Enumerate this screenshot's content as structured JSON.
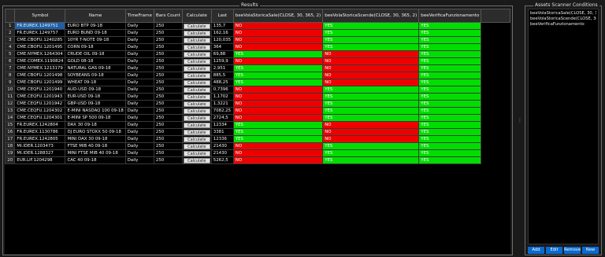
{
  "results_panel": {
    "title": "Results"
  },
  "conditions_panel": {
    "title": "Assets Scanner Conditions",
    "items": [
      "beeVolaStoricaSale(CLOSE, 30, 365, 2)",
      "beeVolaStoricaScende(CLOSE, 30, 365, 2)",
      "beeVerificaFunzionamento"
    ],
    "buttons": {
      "add": "Add",
      "edit": "Edit",
      "remove": "Remove",
      "new": "New"
    }
  },
  "table": {
    "headers": [
      "",
      "Symbol",
      "Name",
      "TimeFrame",
      "Bars Count",
      "Calculate",
      "Last",
      "beeVolaStoricaSale(CLOSE, 30, 365, 2)",
      "beeVolaStoricaScende(CLOSE, 30, 365, 2)",
      "beeVerificaFunzionamento"
    ],
    "button_label": "Calculate",
    "rows": [
      {
        "n": "1",
        "symbol": "FR.EUREX.1249751",
        "name": "EURO BTP 09-18",
        "tf": "Daily",
        "bars": "250",
        "last": "135,7",
        "c1": "NO",
        "c2": "YES",
        "c3": "YES"
      },
      {
        "n": "2",
        "symbol": "FR.EUREX.1249757",
        "name": "EURO BUND 09-18",
        "tf": "Daily",
        "bars": "250",
        "last": "162,16",
        "c1": "NO",
        "c2": "YES",
        "c3": "YES"
      },
      {
        "n": "3",
        "symbol": "CME.CBOFU.1240285",
        "name": "10YR T-NOTE 09-18",
        "tf": "Daily",
        "bars": "250",
        "last": "120,035",
        "c1": "NO",
        "c2": "YES",
        "c3": "YES"
      },
      {
        "n": "4",
        "symbol": "CME.CBOFU.1201495",
        "name": "CORN 09-18",
        "tf": "Daily",
        "bars": "250",
        "last": "364",
        "c1": "NO",
        "c2": "YES",
        "c3": "YES"
      },
      {
        "n": "5",
        "symbol": "CME.NYMEX.1264304",
        "name": "CRUDE OIL 09-18",
        "tf": "Daily",
        "bars": "250",
        "last": "69,88",
        "c1": "YES",
        "c2": "NO",
        "c3": "YES"
      },
      {
        "n": "6",
        "symbol": "CME.COMEX.1190824",
        "name": "GOLD 08-18",
        "tf": "Daily",
        "bars": "250",
        "last": "1259,9",
        "c1": "NO",
        "c2": "NO",
        "c3": "YES"
      },
      {
        "n": "7",
        "symbol": "CME.NYMEX.1213179",
        "name": "NATURAL GAS 09-18",
        "tf": "Daily",
        "bars": "250",
        "last": "2,951",
        "c1": "YES",
        "c2": "NO",
        "c3": "YES"
      },
      {
        "n": "8",
        "symbol": "CME.CBOFU.1201498",
        "name": "SOYBEANS 09-18",
        "tf": "Daily",
        "bars": "250",
        "last": "885,5",
        "c1": "YES",
        "c2": "NO",
        "c3": "YES"
      },
      {
        "n": "9",
        "symbol": "CME.CBOFU.1201499",
        "name": "WHEAT 09-18",
        "tf": "Daily",
        "bars": "250",
        "last": "488,25",
        "c1": "YES",
        "c2": "NO",
        "c3": "YES"
      },
      {
        "n": "10",
        "symbol": "CME.CEQFU.1201940",
        "name": "AUD-USD 09-18",
        "tf": "Daily",
        "bars": "250",
        "last": "0,7396",
        "c1": "NO",
        "c2": "YES",
        "c3": "YES"
      },
      {
        "n": "11",
        "symbol": "CME.CEQFU.1201943",
        "name": "EUR-USD 09-18",
        "tf": "Daily",
        "bars": "250",
        "last": "1,1702",
        "c1": "NO",
        "c2": "YES",
        "c3": "YES"
      },
      {
        "n": "12",
        "symbol": "CME.CEQFU.1201942",
        "name": "GBP-USD 09-18",
        "tf": "Daily",
        "bars": "250",
        "last": "1,3221",
        "c1": "NO",
        "c2": "YES",
        "c3": "YES"
      },
      {
        "n": "13",
        "symbol": "CME.CEQFU.1204302",
        "name": "E-MINI NASDAQ 100 09-18",
        "tf": "Daily",
        "bars": "250",
        "last": "7082,25",
        "c1": "NO",
        "c2": "YES",
        "c3": "YES"
      },
      {
        "n": "14",
        "symbol": "CME.CEQFU.1204301",
        "name": "E-MINI SP 500 09-18",
        "tf": "Daily",
        "bars": "250",
        "last": "2724,5",
        "c1": "NO",
        "c2": "YES",
        "c3": "YES"
      },
      {
        "n": "15",
        "symbol": "FR.EUREX.1242804",
        "name": "DAX 30 09-18",
        "tf": "Daily",
        "bars": "250",
        "last": "12334",
        "c1": "YES",
        "c2": "NO",
        "c3": "YES"
      },
      {
        "n": "16",
        "symbol": "FR.EUREX.1130786",
        "name": "DJ EURO STOXX 50 09-18",
        "tf": "Daily",
        "bars": "250",
        "last": "3381",
        "c1": "YES",
        "c2": "NO",
        "c3": "YES"
      },
      {
        "n": "17",
        "symbol": "FR.EUREX.1242805",
        "name": "MINI DAX 30 09-18",
        "tf": "Daily",
        "bars": "250",
        "last": "12336",
        "c1": "YES",
        "c2": "NO",
        "c3": "YES"
      },
      {
        "n": "18",
        "symbol": "MI.IDER.1203473",
        "name": "FTSE MIB 40 09-18",
        "tf": "Daily",
        "bars": "250",
        "last": "21430",
        "c1": "NO",
        "c2": "YES",
        "c3": "YES"
      },
      {
        "n": "19",
        "symbol": "MI.IDER.1288327",
        "name": "MINI FTSE MIB 40 09-18",
        "tf": "Daily",
        "bars": "250",
        "last": "21430",
        "c1": "NO",
        "c2": "YES",
        "c3": "YES"
      },
      {
        "n": "20",
        "symbol": "EUR.LIF.1204298",
        "name": "CAC 40 09-18",
        "tf": "Daily",
        "bars": "250",
        "last": "5262,5",
        "c1": "NO",
        "c2": "YES",
        "c3": "YES"
      }
    ]
  },
  "colors": {
    "yes": "#00dd00",
    "no": "#ee0000",
    "selected": "#1e5fa8",
    "button_blue": "#0a6bd1"
  }
}
